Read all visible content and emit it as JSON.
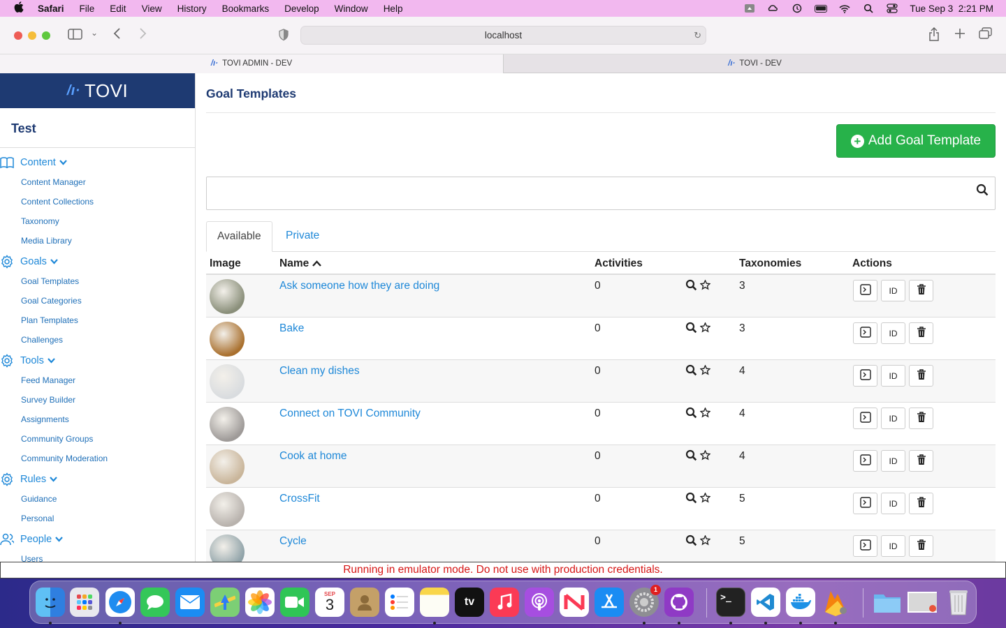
{
  "menubar": {
    "app_name": "Safari",
    "items": [
      "File",
      "Edit",
      "View",
      "History",
      "Bookmarks",
      "Develop",
      "Window",
      "Help"
    ],
    "clock": "Tue Sep 3  2:21 PM"
  },
  "browser": {
    "url": "localhost",
    "tabs": [
      {
        "label": "TOVI ADMIN - DEV",
        "active": true
      },
      {
        "label": "TOVI - DEV",
        "active": false
      }
    ]
  },
  "sidebar": {
    "brand": "TOVI",
    "org_name": "Test",
    "sections": [
      {
        "label": "Content",
        "icon": "book-icon",
        "items": [
          "Content Manager",
          "Content Collections",
          "Taxonomy",
          "Media Library"
        ]
      },
      {
        "label": "Goals",
        "icon": "gear-icon",
        "items": [
          "Goal Templates",
          "Goal Categories",
          "Plan Templates",
          "Challenges"
        ]
      },
      {
        "label": "Tools",
        "icon": "gear-icon",
        "items": [
          "Feed Manager",
          "Survey Builder",
          "Assignments",
          "Community Groups",
          "Community Moderation"
        ]
      },
      {
        "label": "Rules",
        "icon": "gear-icon",
        "items": [
          "Guidance",
          "Personal"
        ]
      },
      {
        "label": "People",
        "icon": "people-icon",
        "items": [
          "Users"
        ]
      }
    ]
  },
  "main": {
    "title": "Goal Templates",
    "add_button": "Add Goal Template",
    "search_value": "",
    "tabs": [
      "Available",
      "Private"
    ],
    "columns": {
      "image": "Image",
      "name": "Name",
      "activities": "Activities",
      "taxonomies": "Taxonomies",
      "actions": "Actions"
    },
    "id_button": "ID",
    "rows": [
      {
        "name": "Ask someone how they are doing",
        "activities": "0",
        "taxonomies": "3",
        "thumb_color": "#8a8f7a"
      },
      {
        "name": "Bake",
        "activities": "0",
        "taxonomies": "3",
        "thumb_color": "#a9702e"
      },
      {
        "name": "Clean my dishes",
        "activities": "0",
        "taxonomies": "4",
        "thumb_color": "#d9dcdf"
      },
      {
        "name": "Connect on TOVI Community",
        "activities": "0",
        "taxonomies": "4",
        "thumb_color": "#9e9a98"
      },
      {
        "name": "Cook at home",
        "activities": "0",
        "taxonomies": "4",
        "thumb_color": "#c9b59a"
      },
      {
        "name": "CrossFit",
        "activities": "0",
        "taxonomies": "5",
        "thumb_color": "#b8b2ad"
      },
      {
        "name": "Cycle",
        "activities": "0",
        "taxonomies": "5",
        "thumb_color": "#8fa2a8"
      }
    ]
  },
  "banner": "Running in emulator mode. Do not use with production credentials.",
  "dock": {
    "calendar_month": "SEP",
    "calendar_day": "3",
    "settings_badge": "1",
    "tv_label": "tv"
  },
  "colors": {
    "brand_navy": "#1e3a72",
    "link_blue": "#1e88d8",
    "add_green": "#27b24a",
    "banner_red": "#d61515"
  }
}
